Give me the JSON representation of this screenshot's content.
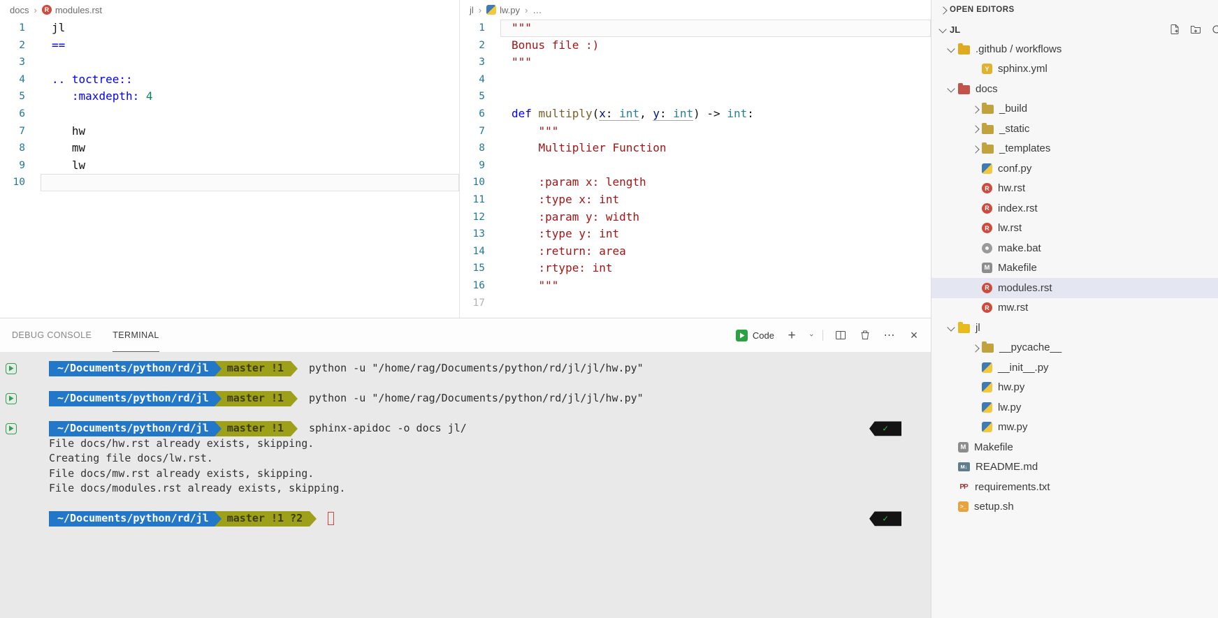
{
  "colors": {
    "keyword": "#0000ff",
    "string": "#a31515",
    "number": "#098658",
    "function": "#795e26",
    "parameter": "#001080",
    "type": "#267f99",
    "line_number": "#237893",
    "prompt_path_bg": "#2277c8",
    "prompt_git_bg": "#9da018",
    "selection_bg": "#e4e6f1",
    "decoration_green": "#30a14e",
    "check_green": "#2fbe4e",
    "cursor_red": "#d0453f"
  },
  "left_editor": {
    "breadcrumb": [
      {
        "label": "docs"
      },
      {
        "label": "modules.rst",
        "icon": "rst-icon"
      }
    ],
    "lines": [
      {
        "n": 1,
        "seg": [
          {
            "t": "jl",
            "s": "plain"
          }
        ]
      },
      {
        "n": 2,
        "seg": [
          {
            "t": "==",
            "s": "kw"
          }
        ]
      },
      {
        "n": 3,
        "seg": []
      },
      {
        "n": 4,
        "seg": [
          {
            "t": ".. toctree::",
            "s": "kw"
          }
        ]
      },
      {
        "n": 5,
        "seg": [
          {
            "t": "   ",
            "s": "plain"
          },
          {
            "t": ":maxdepth:",
            "s": "kw"
          },
          {
            "t": " ",
            "s": "plain"
          },
          {
            "t": "4",
            "s": "num"
          }
        ]
      },
      {
        "n": 6,
        "seg": []
      },
      {
        "n": 7,
        "seg": [
          {
            "t": "   hw",
            "s": "plain"
          }
        ]
      },
      {
        "n": 8,
        "seg": [
          {
            "t": "   mw",
            "s": "plain"
          }
        ]
      },
      {
        "n": 9,
        "seg": [
          {
            "t": "   lw",
            "s": "plain"
          }
        ]
      },
      {
        "n": 10,
        "seg": [],
        "active": true
      }
    ]
  },
  "right_editor": {
    "breadcrumb": [
      {
        "label": "jl"
      },
      {
        "label": "lw.py",
        "icon": "python-icon"
      },
      {
        "label": "…"
      }
    ],
    "lines": [
      {
        "n": 1,
        "active": true,
        "seg": [
          {
            "t": "\"\"\"",
            "s": "str"
          }
        ]
      },
      {
        "n": 2,
        "seg": [
          {
            "t": "Bonus file :)",
            "s": "str"
          }
        ]
      },
      {
        "n": 3,
        "seg": [
          {
            "t": "\"\"\"",
            "s": "str"
          }
        ]
      },
      {
        "n": 4,
        "seg": []
      },
      {
        "n": 5,
        "seg": []
      },
      {
        "n": 6,
        "seg": [
          {
            "t": "def",
            "s": "kw"
          },
          {
            "t": " ",
            "s": "plain"
          },
          {
            "t": "multiply",
            "s": "func"
          },
          {
            "t": "(",
            "s": "plain"
          },
          {
            "t": "x",
            "s": "param u"
          },
          {
            "t": ": ",
            "s": "plain u"
          },
          {
            "t": "int",
            "s": "type u"
          },
          {
            "t": ", ",
            "s": "plain"
          },
          {
            "t": "y",
            "s": "param u"
          },
          {
            "t": ": ",
            "s": "plain u"
          },
          {
            "t": "int",
            "s": "type u"
          },
          {
            "t": ") -> ",
            "s": "plain"
          },
          {
            "t": "int",
            "s": "type"
          },
          {
            "t": ":",
            "s": "plain"
          }
        ]
      },
      {
        "n": 7,
        "seg": [
          {
            "t": "    \"\"\"",
            "s": "str"
          }
        ]
      },
      {
        "n": 8,
        "seg": [
          {
            "t": "    Multiplier Function",
            "s": "str"
          }
        ]
      },
      {
        "n": 9,
        "seg": []
      },
      {
        "n": 10,
        "seg": [
          {
            "t": "    :param x: length",
            "s": "str"
          }
        ]
      },
      {
        "n": 11,
        "seg": [
          {
            "t": "    :type x: int",
            "s": "str"
          }
        ]
      },
      {
        "n": 12,
        "seg": [
          {
            "t": "    :param y: width",
            "s": "str"
          }
        ]
      },
      {
        "n": 13,
        "seg": [
          {
            "t": "    :type y: int",
            "s": "str"
          }
        ]
      },
      {
        "n": 14,
        "seg": [
          {
            "t": "    :return: area",
            "s": "str"
          }
        ]
      },
      {
        "n": 15,
        "seg": [
          {
            "t": "    :rtype: int",
            "s": "str"
          }
        ]
      },
      {
        "n": 16,
        "seg": [
          {
            "t": "    \"\"\"",
            "s": "str"
          }
        ]
      },
      {
        "n": 17,
        "seg": [],
        "dim": true
      }
    ]
  },
  "panel": {
    "tabs": [
      {
        "label": "DEBUG CONSOLE",
        "active": false
      },
      {
        "label": "TERMINAL",
        "active": true
      }
    ],
    "launcher_label": "Code",
    "action_icons": [
      "new-terminal-icon",
      "launch-profile-chevron-icon",
      "split-terminal-icon",
      "kill-terminal-icon",
      "more-actions-icon",
      "close-panel-icon"
    ],
    "terminal": {
      "prompt_path": "~/Documents/python/rd/jl",
      "rows": [
        {
          "type": "command",
          "git": "master !1",
          "cmd": "python -u \"/home/rag/Documents/python/rd/jl/jl/hw.py\"",
          "decoration": true
        },
        {
          "type": "blank"
        },
        {
          "type": "command",
          "git": "master !1",
          "cmd": "python -u \"/home/rag/Documents/python/rd/jl/jl/hw.py\"",
          "decoration": true
        },
        {
          "type": "blank"
        },
        {
          "type": "command",
          "git": "master !1",
          "cmd": "sphinx-apidoc -o docs jl/",
          "decoration": true,
          "check": true
        },
        {
          "type": "output",
          "text": "File docs/hw.rst already exists, skipping."
        },
        {
          "type": "output",
          "text": "Creating file docs/lw.rst."
        },
        {
          "type": "output",
          "text": "File docs/mw.rst already exists, skipping."
        },
        {
          "type": "output",
          "text": "File docs/modules.rst already exists, skipping."
        },
        {
          "type": "blank"
        },
        {
          "type": "command",
          "git": "master !1 ?2",
          "cmd": "",
          "cursor": true,
          "check": true
        }
      ]
    }
  },
  "sidebar": {
    "open_editors_label": "OPEN EDITORS",
    "root_label": "JL",
    "header_action_icons": [
      "new-file-icon",
      "new-folder-icon",
      "refresh-icon"
    ],
    "tree": [
      {
        "label": ".github / workflows",
        "icon": "folder",
        "folder_color": "#dfa920",
        "level": 1,
        "chevron": "down"
      },
      {
        "label": "sphinx.yml",
        "icon": "yml",
        "level": 2
      },
      {
        "label": "docs",
        "icon": "folder",
        "folder_color": "#c3524a",
        "level": 1,
        "chevron": "down"
      },
      {
        "label": "_build",
        "icon": "folder",
        "folder_color": "#c2a23c",
        "level": 2,
        "chevron": "right"
      },
      {
        "label": "_static",
        "icon": "folder",
        "folder_color": "#c2a23c",
        "level": 2,
        "chevron": "right"
      },
      {
        "label": "_templates",
        "icon": "folder",
        "folder_color": "#c2a23c",
        "level": 2,
        "chevron": "right"
      },
      {
        "label": "conf.py",
        "icon": "py",
        "level": 2
      },
      {
        "label": "hw.rst",
        "icon": "rst",
        "level": 2
      },
      {
        "label": "index.rst",
        "icon": "rst",
        "level": 2
      },
      {
        "label": "lw.rst",
        "icon": "rst",
        "level": 2
      },
      {
        "label": "make.bat",
        "icon": "bat",
        "level": 2
      },
      {
        "label": "Makefile",
        "icon": "make",
        "level": 2
      },
      {
        "label": "modules.rst",
        "icon": "rst",
        "level": 2,
        "selected": true
      },
      {
        "label": "mw.rst",
        "icon": "rst",
        "level": 2
      },
      {
        "label": "jl",
        "icon": "folder",
        "folder_color": "#e7bb1c",
        "level": 1,
        "chevron": "down"
      },
      {
        "label": "__pycache__",
        "icon": "folder",
        "folder_color": "#c2a23c",
        "level": 2,
        "chevron": "right"
      },
      {
        "label": "__init__.py",
        "icon": "py",
        "level": 2
      },
      {
        "label": "hw.py",
        "icon": "py",
        "level": 2
      },
      {
        "label": "lw.py",
        "icon": "py",
        "level": 2
      },
      {
        "label": "mw.py",
        "icon": "py",
        "level": 2
      },
      {
        "label": "Makefile",
        "icon": "make",
        "level": 1
      },
      {
        "label": "README.md",
        "icon": "md",
        "level": 1
      },
      {
        "label": "requirements.txt",
        "icon": "req",
        "level": 1
      },
      {
        "label": "setup.sh",
        "icon": "sh",
        "level": 1
      }
    ]
  }
}
